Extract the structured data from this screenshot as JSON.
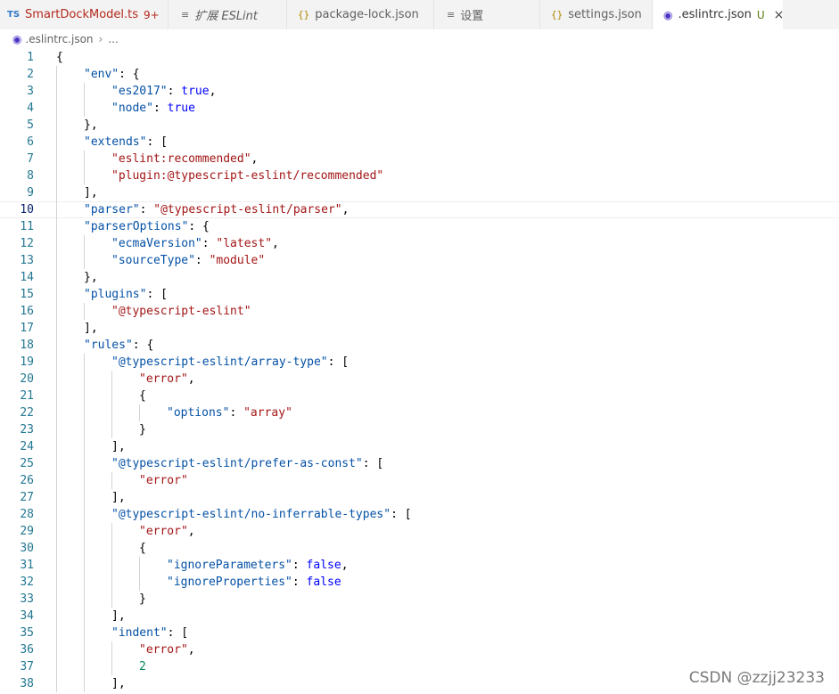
{
  "tabs": [
    {
      "icon": "TS",
      "label": "SmartDockModel.ts",
      "badge": "9+",
      "state": "error"
    },
    {
      "icon": "≡",
      "label": "扩展 ESLint",
      "state": "preview"
    },
    {
      "icon": "{}",
      "label": "package-lock.json",
      "state": "normal"
    },
    {
      "icon": "≡",
      "label": "设置",
      "state": "normal"
    },
    {
      "icon": "{}",
      "label": "settings.json",
      "state": "normal"
    },
    {
      "icon": "◉",
      "label": ".eslintrc.json",
      "status": "U",
      "close": "×",
      "state": "active"
    }
  ],
  "breadcrumb": {
    "file": ".eslintrc.json",
    "separator": "›",
    "tail": "..."
  },
  "current_line": 10,
  "code_lines": [
    {
      "n": "1",
      "i": 0,
      "t": [
        [
          "p",
          "{"
        ]
      ]
    },
    {
      "n": "2",
      "i": 1,
      "t": [
        [
          "k",
          "\"env\""
        ],
        [
          "p",
          ": {"
        ]
      ]
    },
    {
      "n": "3",
      "i": 2,
      "t": [
        [
          "k",
          "\"es2017\""
        ],
        [
          "p",
          ": "
        ],
        [
          "b",
          "true"
        ],
        [
          "p",
          ","
        ]
      ]
    },
    {
      "n": "4",
      "i": 2,
      "t": [
        [
          "k",
          "\"node\""
        ],
        [
          "p",
          ": "
        ],
        [
          "b",
          "true"
        ]
      ]
    },
    {
      "n": "5",
      "i": 1,
      "t": [
        [
          "p",
          "},"
        ]
      ]
    },
    {
      "n": "6",
      "i": 1,
      "t": [
        [
          "k",
          "\"extends\""
        ],
        [
          "p",
          ": ["
        ]
      ]
    },
    {
      "n": "7",
      "i": 2,
      "t": [
        [
          "s",
          "\"eslint:recommended\""
        ],
        [
          "p",
          ","
        ]
      ]
    },
    {
      "n": "8",
      "i": 2,
      "t": [
        [
          "s",
          "\"plugin:@typescript-eslint/recommended\""
        ]
      ]
    },
    {
      "n": "9",
      "i": 1,
      "t": [
        [
          "p",
          "],"
        ]
      ]
    },
    {
      "n": "10",
      "i": 1,
      "t": [
        [
          "k",
          "\"parser\""
        ],
        [
          "p",
          ": "
        ],
        [
          "s",
          "\"@typescript-eslint/parser\""
        ],
        [
          "p",
          ","
        ]
      ]
    },
    {
      "n": "11",
      "i": 1,
      "t": [
        [
          "k",
          "\"parserOptions\""
        ],
        [
          "p",
          ": {"
        ]
      ]
    },
    {
      "n": "12",
      "i": 2,
      "t": [
        [
          "k",
          "\"ecmaVersion\""
        ],
        [
          "p",
          ": "
        ],
        [
          "s",
          "\"latest\""
        ],
        [
          "p",
          ","
        ]
      ]
    },
    {
      "n": "13",
      "i": 2,
      "t": [
        [
          "k",
          "\"sourceType\""
        ],
        [
          "p",
          ": "
        ],
        [
          "s",
          "\"module\""
        ]
      ]
    },
    {
      "n": "14",
      "i": 1,
      "t": [
        [
          "p",
          "},"
        ]
      ]
    },
    {
      "n": "15",
      "i": 1,
      "t": [
        [
          "k",
          "\"plugins\""
        ],
        [
          "p",
          ": ["
        ]
      ]
    },
    {
      "n": "16",
      "i": 2,
      "t": [
        [
          "s",
          "\"@typescript-eslint\""
        ]
      ]
    },
    {
      "n": "17",
      "i": 1,
      "t": [
        [
          "p",
          "],"
        ]
      ]
    },
    {
      "n": "18",
      "i": 1,
      "t": [
        [
          "k",
          "\"rules\""
        ],
        [
          "p",
          ": {"
        ]
      ]
    },
    {
      "n": "19",
      "i": 2,
      "t": [
        [
          "k",
          "\"@typescript-eslint/array-type\""
        ],
        [
          "p",
          ": ["
        ]
      ]
    },
    {
      "n": "20",
      "i": 3,
      "t": [
        [
          "s",
          "\"error\""
        ],
        [
          "p",
          ","
        ]
      ]
    },
    {
      "n": "21",
      "i": 3,
      "t": [
        [
          "p",
          "{"
        ]
      ]
    },
    {
      "n": "22",
      "i": 4,
      "t": [
        [
          "k",
          "\"options\""
        ],
        [
          "p",
          ": "
        ],
        [
          "s",
          "\"array\""
        ]
      ]
    },
    {
      "n": "23",
      "i": 3,
      "t": [
        [
          "p",
          "}"
        ]
      ]
    },
    {
      "n": "24",
      "i": 2,
      "t": [
        [
          "p",
          "],"
        ]
      ]
    },
    {
      "n": "25",
      "i": 2,
      "t": [
        [
          "k",
          "\"@typescript-eslint/prefer-as-const\""
        ],
        [
          "p",
          ": ["
        ]
      ]
    },
    {
      "n": "26",
      "i": 3,
      "t": [
        [
          "s",
          "\"error\""
        ]
      ]
    },
    {
      "n": "27",
      "i": 2,
      "t": [
        [
          "p",
          "],"
        ]
      ]
    },
    {
      "n": "28",
      "i": 2,
      "t": [
        [
          "k",
          "\"@typescript-eslint/no-inferrable-types\""
        ],
        [
          "p",
          ": ["
        ]
      ]
    },
    {
      "n": "29",
      "i": 3,
      "t": [
        [
          "s",
          "\"error\""
        ],
        [
          "p",
          ","
        ]
      ]
    },
    {
      "n": "30",
      "i": 3,
      "t": [
        [
          "p",
          "{"
        ]
      ]
    },
    {
      "n": "31",
      "i": 4,
      "t": [
        [
          "k",
          "\"ignoreParameters\""
        ],
        [
          "p",
          ": "
        ],
        [
          "b",
          "false"
        ],
        [
          "p",
          ","
        ]
      ]
    },
    {
      "n": "32",
      "i": 4,
      "t": [
        [
          "k",
          "\"ignoreProperties\""
        ],
        [
          "p",
          ": "
        ],
        [
          "b",
          "false"
        ]
      ]
    },
    {
      "n": "33",
      "i": 3,
      "t": [
        [
          "p",
          "}"
        ]
      ]
    },
    {
      "n": "34",
      "i": 2,
      "t": [
        [
          "p",
          "],"
        ]
      ]
    },
    {
      "n": "35",
      "i": 2,
      "t": [
        [
          "k",
          "\"indent\""
        ],
        [
          "p",
          ": ["
        ]
      ]
    },
    {
      "n": "36",
      "i": 3,
      "t": [
        [
          "s",
          "\"error\""
        ],
        [
          "p",
          ","
        ]
      ]
    },
    {
      "n": "37",
      "i": 3,
      "t": [
        [
          "n",
          "2"
        ]
      ]
    },
    {
      "n": "38",
      "i": 2,
      "t": [
        [
          "p",
          "],"
        ]
      ]
    }
  ],
  "watermark": "CSDN @zzjj23233",
  "colors": {
    "key": "#0451a5",
    "string": "#a31515",
    "boolean": "#0000ff",
    "number": "#098658",
    "line_number": "#237893"
  }
}
